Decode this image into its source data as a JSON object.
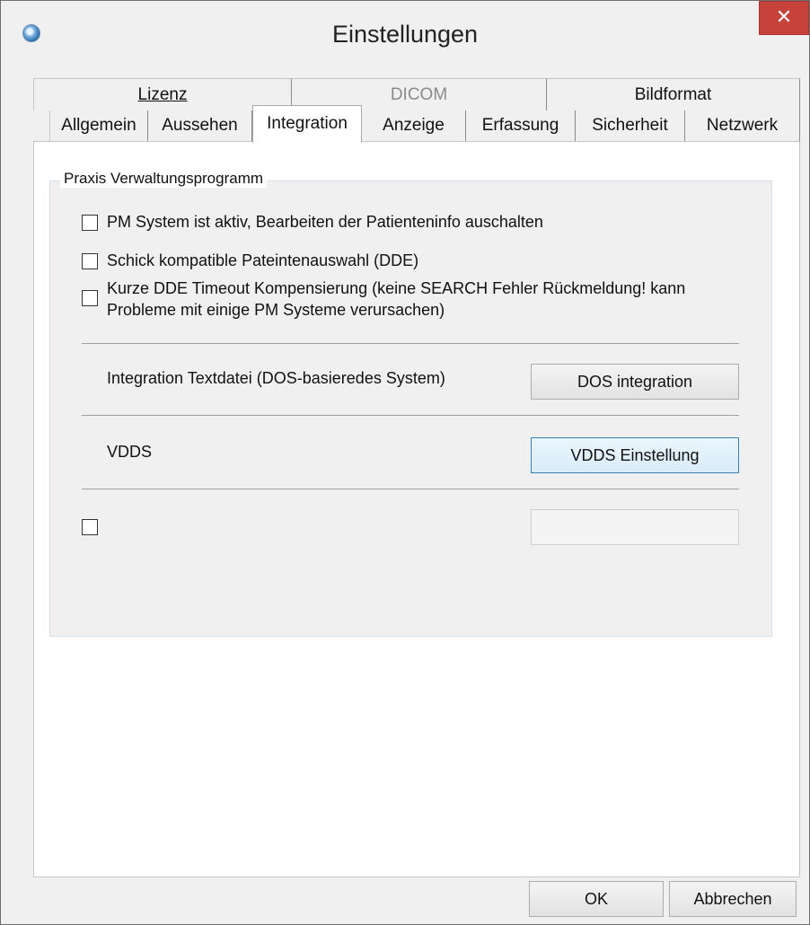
{
  "window": {
    "title": "Einstellungen",
    "close_glyph": "✕"
  },
  "tabs": {
    "row1": [
      {
        "label": "Lizenz",
        "enabled": true
      },
      {
        "label": "DICOM",
        "enabled": false
      },
      {
        "label": "Bildformat",
        "enabled": true
      }
    ],
    "row2": [
      {
        "label": "Allgemein"
      },
      {
        "label": "Aussehen"
      },
      {
        "label": "Integration",
        "active": true
      },
      {
        "label": "Anzeige"
      },
      {
        "label": "Erfassung"
      },
      {
        "label": "Sicherheit"
      },
      {
        "label": "Netzwerk"
      }
    ]
  },
  "group": {
    "title": "Praxis Verwaltungsprogramm",
    "options": [
      {
        "label": "PM System ist aktiv, Bearbeiten der Patienteninfo auschalten",
        "checked": false
      },
      {
        "label": "Schick kompatible Pateintenauswahl (DDE)",
        "checked": false
      },
      {
        "label_line1": "Kurze DDE Timeout Kompensierung (keine SEARCH Fehler Rückmeldung! kann",
        "label_line2": "Probleme mit einige PM Systeme verursachen)",
        "checked": false
      }
    ],
    "dos": {
      "label": "Integration Textdatei (DOS-basieredes System)",
      "button": "DOS integration"
    },
    "vdds": {
      "label": "VDDS",
      "button": "VDDS Einstellung"
    },
    "extra": {
      "checked": false,
      "button_enabled": false
    }
  },
  "footer": {
    "ok": "OK",
    "cancel": "Abbrechen"
  },
  "colors": {
    "close_button": "#c7423a",
    "default_button_border": "#3c7fb1",
    "disabled_tab_text": "#8a8a8a"
  }
}
